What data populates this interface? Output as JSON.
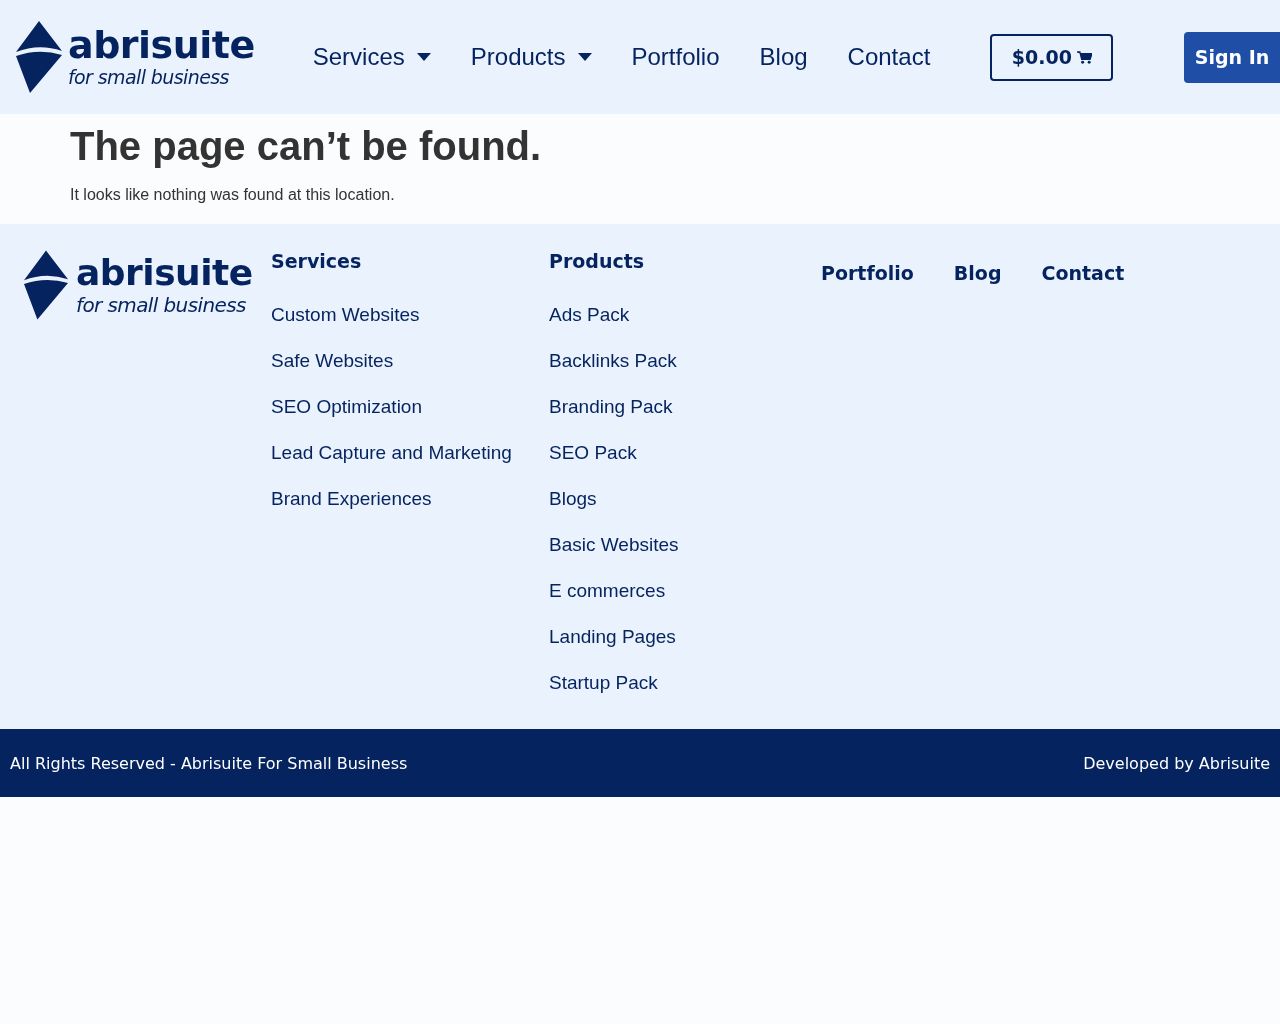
{
  "header": {
    "logo": {
      "name": "abrisuite",
      "tagline": "for small business"
    },
    "nav": [
      {
        "label": "Services",
        "kind": "dropdown"
      },
      {
        "label": "Products",
        "kind": "dropdown"
      },
      {
        "label": "Portfolio",
        "kind": "link"
      },
      {
        "label": "Blog",
        "kind": "link"
      },
      {
        "label": "Contact",
        "kind": "link"
      }
    ],
    "cart": "$0.00",
    "sign_in": "Sign In"
  },
  "main": {
    "title": "The page can’t be found.",
    "message": "It looks like nothing was found at this location."
  },
  "footer": {
    "logo": {
      "name": "abrisuite",
      "tagline": "for small business"
    },
    "columns": [
      {
        "heading": "Services",
        "links": [
          "Custom Websites",
          "Safe Websites",
          "SEO Optimization",
          "Lead Capture and Marketing",
          "Brand Experiences"
        ]
      },
      {
        "heading": "Products",
        "links": [
          "Ads Pack",
          "Backlinks Pack",
          "Branding Pack",
          "SEO Pack",
          "Blogs",
          "Basic Websites",
          "E commerces",
          "Landing Pages",
          "Startup Pack"
        ]
      }
    ],
    "links": [
      "Portfolio",
      "Blog",
      "Contact"
    ]
  },
  "bottom_bar": {
    "copyright": "All Rights Reserved - Abrisuite For Small Business",
    "credit": "Developed by Abrisuite"
  }
}
